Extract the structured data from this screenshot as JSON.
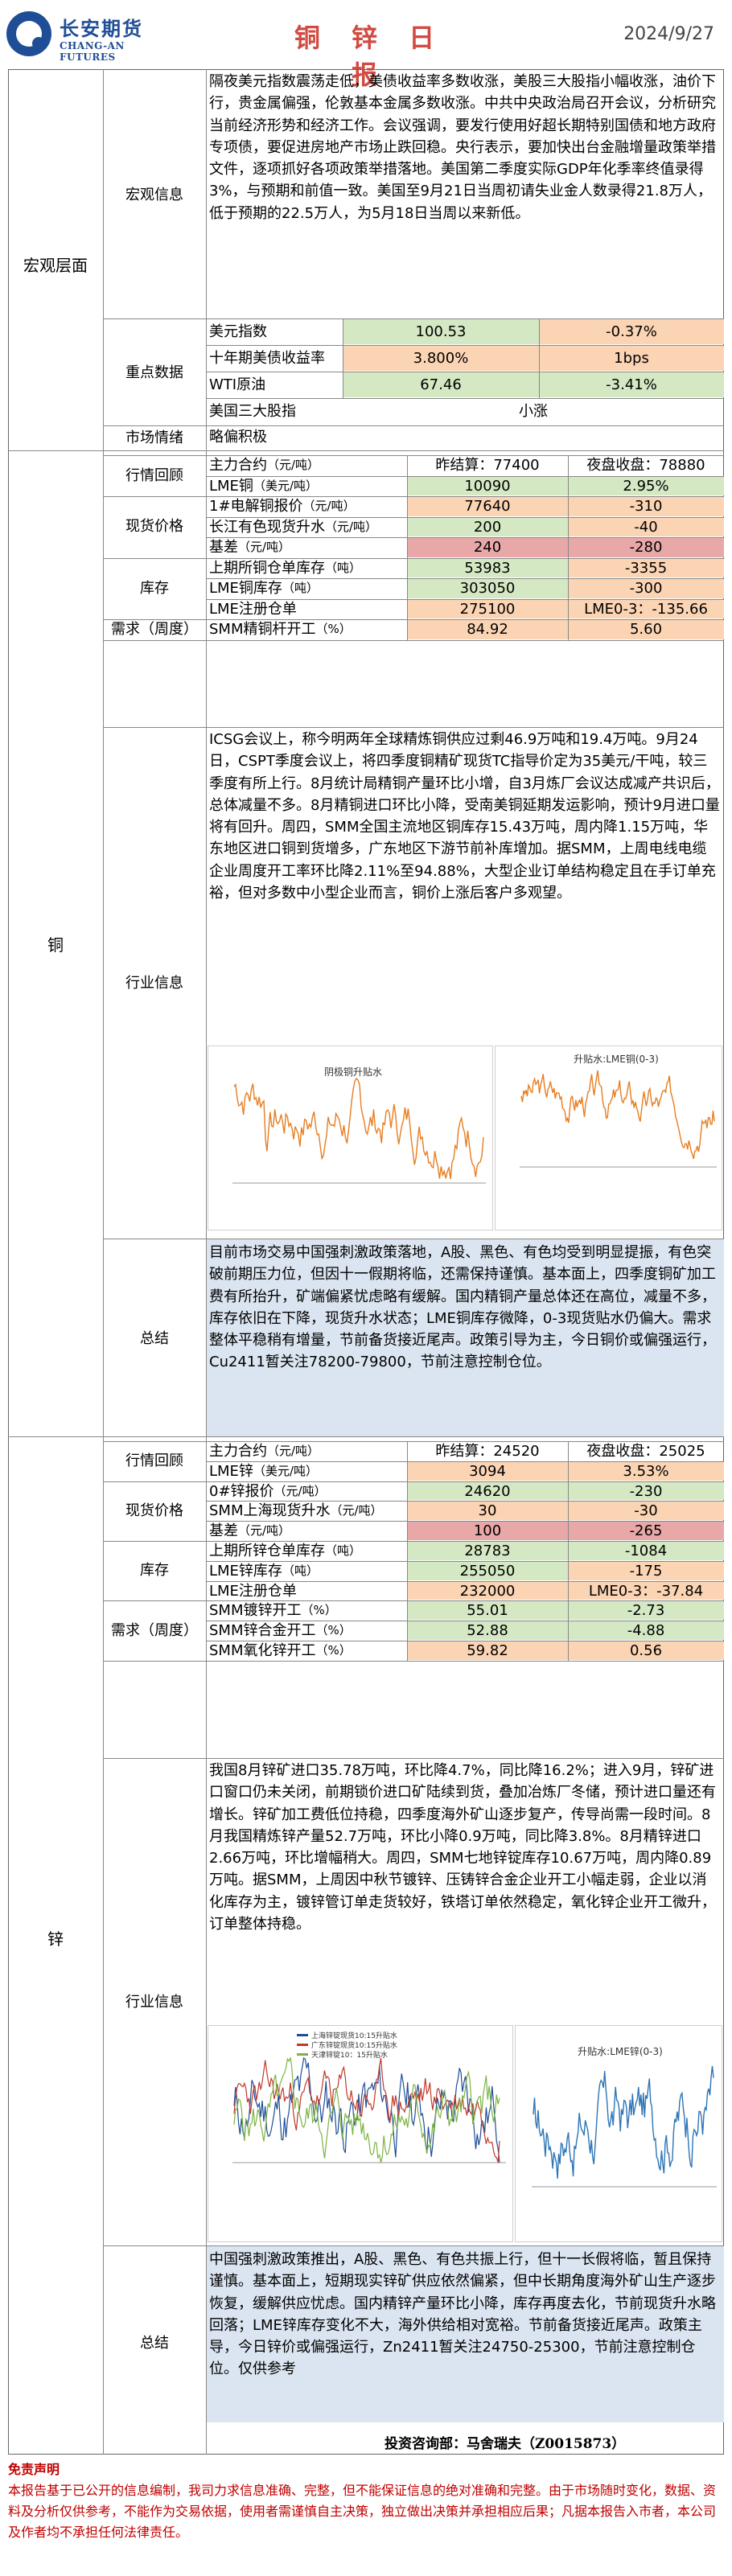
{
  "header": {
    "company_cn": "长安期货",
    "company_en": "CHANG-AN FUTURES",
    "title": "铜 锌 日 报",
    "date": "2024/9/27"
  },
  "macro": {
    "section": "宏观层面",
    "info_label": "宏观信息",
    "info_text": "隔夜美元指数震荡走低，美债收益率多数收涨，美股三大股指小幅收涨，油价下行，贵金属偏强，伦敦基本金属多数收涨。中共中央政治局召开会议，分析研究当前经济形势和经济工作。会议强调，要发行使用好超长期特别国债和地方政府专项债，要促进房地产市场止跌回稳。央行表示，要加快出台金融增量政策举措文件，逐项抓好各项政策举措落地。美国第二季度实际GDP年化季率终值录得3%，与预期和前值一致。美国至9月21日当周初请失业金人数录得21.8万人，低于预期的22.5万人，为5月18日当周以来新低。",
    "key_label": "重点数据",
    "key_rows": [
      {
        "name": "美元指数",
        "value": "100.53",
        "change": "-0.37%"
      },
      {
        "name": "十年期美债收益率",
        "value": "3.800%",
        "change": "1bps"
      },
      {
        "name": "WTI原油",
        "value": "67.46",
        "change": "-3.41%"
      },
      {
        "name": "美国三大股指",
        "value": "",
        "change": "小涨"
      }
    ],
    "sentiment_label": "市场情绪",
    "sentiment_value": "略偏积极"
  },
  "copper": {
    "section": "铜",
    "review_label": "行情回顾",
    "review_rows": [
      {
        "name": "主力合约",
        "unit": "（元/吨）",
        "col1": "昨结算：77400",
        "col2": "夜盘收盘：78880"
      },
      {
        "name": "LME铜",
        "unit": "（美元/吨）",
        "col1": "10090",
        "col2": "2.95%"
      }
    ],
    "spot_label": "现货价格",
    "spot_rows": [
      {
        "name": "1#电解铜报价",
        "unit": "（元/吨）",
        "col1": "77640",
        "col2": "-310"
      },
      {
        "name": "长江有色现货升水",
        "unit": "（元/吨）",
        "col1": "200",
        "col2": "-40"
      },
      {
        "name": "基差",
        "unit": "（元/吨）",
        "col1": "240",
        "col2": "-280"
      }
    ],
    "stock_label": "库存",
    "stock_rows": [
      {
        "name": "上期所铜仓单库存",
        "unit": "（吨）",
        "col1": "53983",
        "col2": "-3355"
      },
      {
        "name": "LME铜库存",
        "unit": "（吨）",
        "col1": "303050",
        "col2": "-300"
      },
      {
        "name": "LME注册仓单",
        "unit": "",
        "col1": "275100",
        "col2": "LME0-3：-135.66"
      }
    ],
    "demand_label": "需求（周度）",
    "demand_rows": [
      {
        "name": "SMM精铜杆开工",
        "unit": "（%）",
        "col1": "84.92",
        "col2": "5.60"
      }
    ],
    "industry_label": "行业信息",
    "industry_text": "ICSG会议上，称今明两年全球精炼铜供应过剩46.9万吨和19.4万吨。9月24日，CSPT季度会议上，将四季度铜精矿现货TC指导价定为35美元/干吨，较三季度有所上行。8月统计局精铜产量环比小增，自3月炼厂会议达成减产共识后，总体减量不多。8月精铜进口环比小降，受南美铜延期发运影响，预计9月进口量将有回升。周四，SMM全国主流地区铜库存15.43万吨，周内降1.15万吨，华东地区进口铜到货增多，广东地区下游节前补库增加。据SMM，上周电线电缆企业周度开工率环比降2.11%至94.88%，大型企业订单结构稳定且在手订单充裕，但对多数中小型企业而言，铜价上涨后客户多观望。",
    "chart1_title": "阴极铜升贴水",
    "chart2_title": "升贴水:LME铜(0-3)",
    "summary_label": "总结",
    "summary_text": "目前市场交易中国强刺激政策落地，A股、黑色、有色均受到明显提振，有色突破前期压力位，但因十一假期将临，还需保持谨慎。基本面上，四季度铜矿加工费有所抬升，矿端偏紧忧虑略有缓解。国内精铜产量总体还在高位，减量不多，库存依旧在下降，现货升水状态；LME铜库存微降，0-3现货贴水仍偏大。需求整体平稳稍有增量，节前备货接近尾声。政策引导为主，今日铜价或偏强运行，Cu2411暂关注78200-79800，节前注意控制仓位。"
  },
  "zinc": {
    "section": "锌",
    "review_label": "行情回顾",
    "review_rows": [
      {
        "name": "主力合约",
        "unit": "（元/吨）",
        "col1": "昨结算：24520",
        "col2": "夜盘收盘：25025"
      },
      {
        "name": "LME锌",
        "unit": "（美元/吨）",
        "col1": "3094",
        "col2": "3.53%"
      }
    ],
    "spot_label": "现货价格",
    "spot_rows": [
      {
        "name": "0#锌报价",
        "unit": "（元/吨）",
        "col1": "24620",
        "col2": "-230"
      },
      {
        "name": "SMM上海现货升水",
        "unit": "（元/吨）",
        "col1": "30",
        "col2": "-30"
      },
      {
        "name": "基差",
        "unit": "（元/吨）",
        "col1": "100",
        "col2": "-265"
      }
    ],
    "stock_label": "库存",
    "stock_rows": [
      {
        "name": "上期所锌仓单库存",
        "unit": "（吨）",
        "col1": "28783",
        "col2": "-1084"
      },
      {
        "name": "LME锌库存",
        "unit": "（吨）",
        "col1": "255050",
        "col2": "-175"
      },
      {
        "name": "LME注册仓单",
        "unit": "",
        "col1": "232000",
        "col2": "LME0-3：-37.84"
      }
    ],
    "demand_label": "需求（周度）",
    "demand_rows": [
      {
        "name": "SMM镀锌开工",
        "unit": "（%）",
        "col1": "55.01",
        "col2": "-2.73"
      },
      {
        "name": "SMM锌合金开工",
        "unit": "（%）",
        "col1": "52.88",
        "col2": "-4.88"
      },
      {
        "name": "SMM氧化锌开工",
        "unit": "（%）",
        "col1": "59.82",
        "col2": "0.56"
      }
    ],
    "industry_label": "行业信息",
    "industry_text": "我国8月锌矿进口35.78万吨，环比降4.7%，同比降16.2%；进入9月，锌矿进口窗口仍未关闭，前期锁价进口矿陆续到货，叠加冶炼厂冬储，预计进口量还有增长。锌矿加工费低位持稳，四季度海外矿山逐步复产，传导尚需一段时间。8月我国精炼锌产量52.7万吨，环比小降0.9万吨，同比降3.8%。8月精锌进口2.66万吨，环比增幅稍大。周四，SMM七地锌锭库存10.67万吨，周内降0.89万吨。据SMM，上周因中秋节镀锌、压铸锌合金企业开工小幅走弱，企业以消化库存为主，镀锌管订单走货较好，铁塔订单依然稳定，氧化锌企业开工微升，订单整体持稳。",
    "chart1_legend": [
      "上海锌锭现货10:15升贴水",
      "广东锌锭现货10:15升贴水",
      "天津锌锭10：15升贴水"
    ],
    "chart2_title": "升贴水:LME锌(0-3)",
    "summary_label": "总结",
    "summary_text": "中国强刺激政策推出，A股、黑色、有色共振上行，但十一长假将临，暂且保持谨慎。基本面上，短期现实锌矿供应依然偏紧，但中长期角度海外矿山生产逐步恢复，缓解供应忧虑。国内精锌产量环比小降，库存再度去化，节前现货升水略回落；LME锌库存变化不大，海外供给相对宽裕。节前备货接近尾声。政策主导，今日锌价或偏强运行，Zn2411暂关注24750-25300，节前注意控制仓位。仅供参考"
  },
  "footer": {
    "analyst": "投资咨询部：马舍瑞夫（Z0015873）",
    "disclaimer_title": "免责声明",
    "disclaimer_text": "本报告基于已公开的信息编制，我司力求信息准确、完整，但不能保证信息的绝对准确和完整。由于市场随时变化，数据、资料及分析仅供参考，不能作为交易依据，使用者需谨慎自主决策，独立做出决策并承担相应后果；凡据本报告入市者，本公司及作者均不承担任何法律责任。"
  },
  "colors": {
    "brand_blue": "#1f4e96",
    "title_red": "#d24a42",
    "cell_green": "#d5e8c4",
    "cell_orange": "#fbd4b4",
    "cell_red": "#e8a8a8",
    "summary_blue": "#dbe5f1",
    "line_orange": "#e67e22",
    "line_blue": "#2e75b6"
  }
}
